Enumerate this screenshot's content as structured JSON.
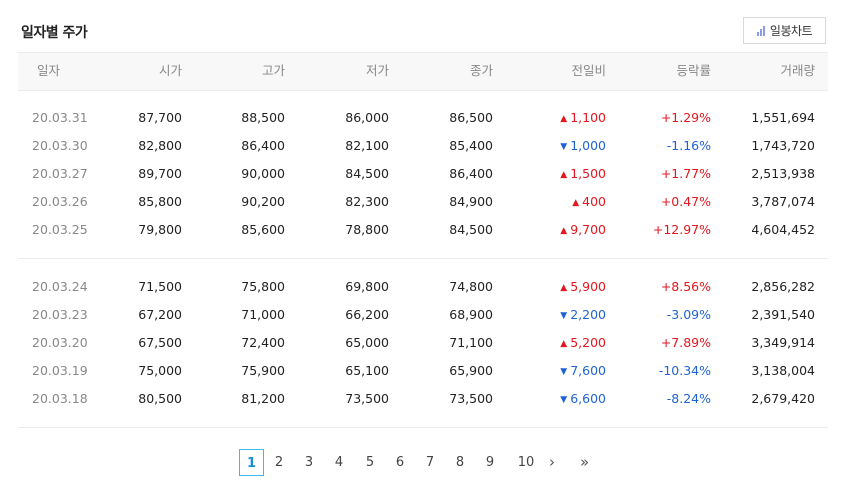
{
  "title": "일자별 주가",
  "chart_button": {
    "label": "일봉차트",
    "icon": "bar-chart-icon"
  },
  "colors": {
    "up": "#e4161f",
    "down": "#1f63d3",
    "accent": "#3cbbe8"
  },
  "columns": [
    "일자",
    "시가",
    "고가",
    "저가",
    "종가",
    "전일비",
    "등락률",
    "거래량"
  ],
  "groups": [
    [
      {
        "date": "20.03.31",
        "open": "87,700",
        "high": "88,500",
        "low": "86,000",
        "close": "86,500",
        "dir": "up",
        "change": "1,100",
        "rate": "+1.29%",
        "volume": "1,551,694"
      },
      {
        "date": "20.03.30",
        "open": "82,800",
        "high": "86,400",
        "low": "82,100",
        "close": "85,400",
        "dir": "down",
        "change": "1,000",
        "rate": "-1.16%",
        "volume": "1,743,720"
      },
      {
        "date": "20.03.27",
        "open": "89,700",
        "high": "90,000",
        "low": "84,500",
        "close": "86,400",
        "dir": "up",
        "change": "1,500",
        "rate": "+1.77%",
        "volume": "2,513,938"
      },
      {
        "date": "20.03.26",
        "open": "85,800",
        "high": "90,200",
        "low": "82,300",
        "close": "84,900",
        "dir": "up",
        "change": "400",
        "rate": "+0.47%",
        "volume": "3,787,074"
      },
      {
        "date": "20.03.25",
        "open": "79,800",
        "high": "85,600",
        "low": "78,800",
        "close": "84,500",
        "dir": "up",
        "change": "9,700",
        "rate": "+12.97%",
        "volume": "4,604,452"
      }
    ],
    [
      {
        "date": "20.03.24",
        "open": "71,500",
        "high": "75,800",
        "low": "69,800",
        "close": "74,800",
        "dir": "up",
        "change": "5,900",
        "rate": "+8.56%",
        "volume": "2,856,282"
      },
      {
        "date": "20.03.23",
        "open": "67,200",
        "high": "71,000",
        "low": "66,200",
        "close": "68,900",
        "dir": "down",
        "change": "2,200",
        "rate": "-3.09%",
        "volume": "2,391,540"
      },
      {
        "date": "20.03.20",
        "open": "67,500",
        "high": "72,400",
        "low": "65,000",
        "close": "71,100",
        "dir": "up",
        "change": "5,200",
        "rate": "+7.89%",
        "volume": "3,349,914"
      },
      {
        "date": "20.03.19",
        "open": "75,000",
        "high": "75,900",
        "low": "65,100",
        "close": "65,900",
        "dir": "down",
        "change": "7,600",
        "rate": "-10.34%",
        "volume": "3,138,004"
      },
      {
        "date": "20.03.18",
        "open": "80,500",
        "high": "81,200",
        "low": "73,500",
        "close": "73,500",
        "dir": "down",
        "change": "6,600",
        "rate": "-8.24%",
        "volume": "2,679,420"
      }
    ]
  ],
  "pagination": {
    "pages": [
      "1",
      "2",
      "3",
      "4",
      "5",
      "6",
      "7",
      "8",
      "9",
      "10"
    ],
    "current": "1",
    "next_icon": "chevron-right-icon",
    "last_icon": "double-chevron-right-icon",
    "next_glyph": "›",
    "last_glyph": "»"
  },
  "arrows": {
    "up": "▲",
    "down": "▼"
  }
}
